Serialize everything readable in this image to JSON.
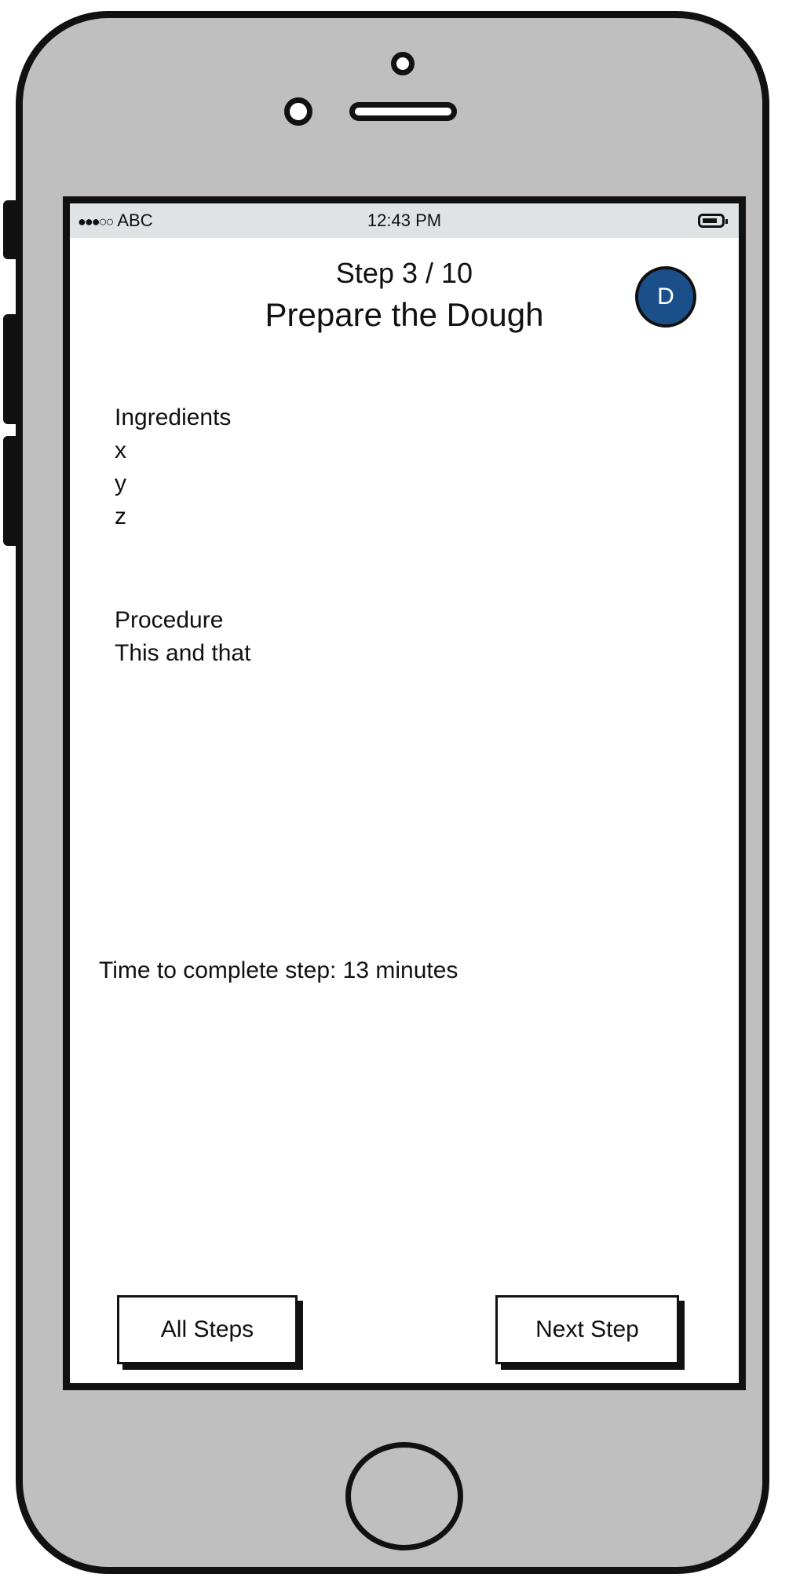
{
  "status_bar": {
    "signal": "●●●○○",
    "carrier": "ABC",
    "time": "12:43 PM",
    "battery_icon": "battery-icon"
  },
  "header": {
    "step_counter": "Step 3 / 10",
    "title": "Prepare the Dough",
    "avatar_initial": "D"
  },
  "ingredients": {
    "heading": "Ingredients",
    "items": [
      "x",
      "y",
      "z"
    ]
  },
  "procedure": {
    "heading": "Procedure",
    "text": "This and that"
  },
  "time_to_complete": "Time to complete step: 13 minutes",
  "buttons": {
    "all_steps": "All Steps",
    "next_step": "Next Step"
  },
  "colors": {
    "avatar": "#1b4f8a",
    "status_bar": "#dfe3e6",
    "device_body": "#bfbfbf"
  }
}
